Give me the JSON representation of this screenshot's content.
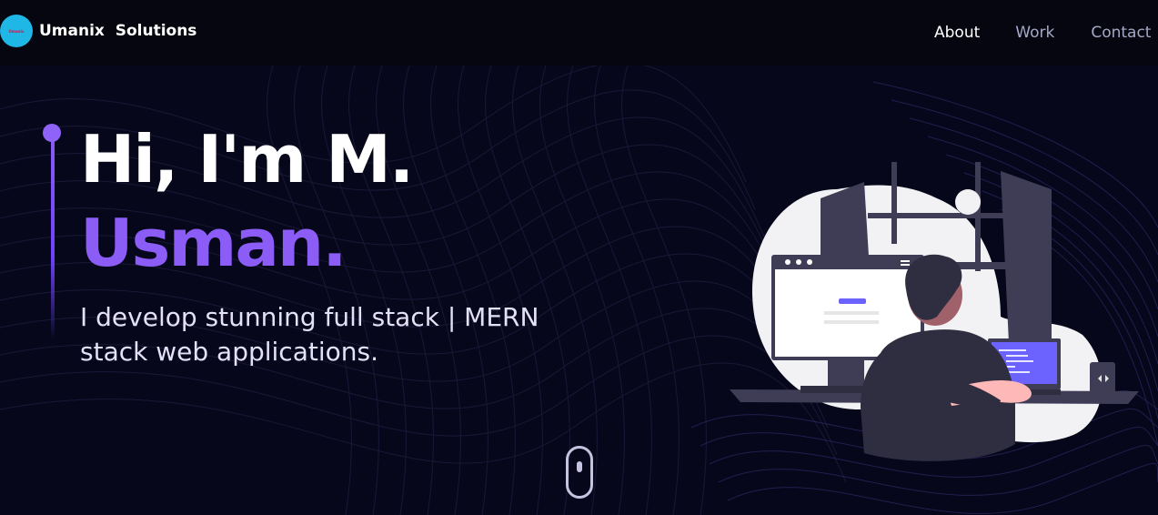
{
  "nav": {
    "logo_text": "Umanix",
    "brand_name": "Umanix  Solutions",
    "links": [
      "About",
      "Work",
      "Contact"
    ]
  },
  "hero": {
    "greeting": "Hi, I'm M.",
    "name": "Usman.",
    "tagline": "I develop stunning full stack | MERN stack web applications."
  },
  "icons": {
    "scroll_indicator": "mouse-scroll-icon",
    "illustration": "developer-at-desk-illustration"
  },
  "colors": {
    "background": "#06071a",
    "accent": "#8b5cf6",
    "logo_bg": "#1fb7e6",
    "text_primary": "#ffffff",
    "nav_muted": "#a5a9c7"
  }
}
